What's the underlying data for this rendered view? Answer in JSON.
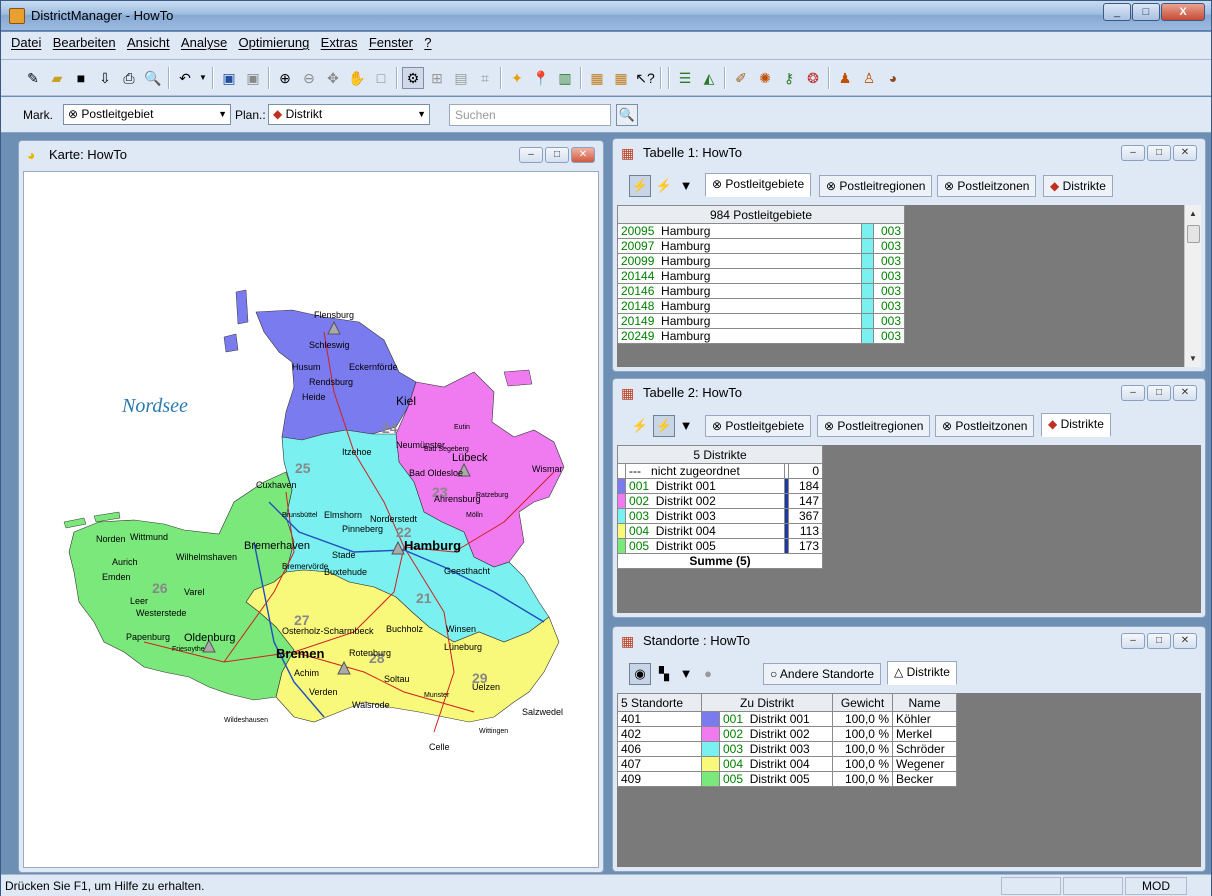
{
  "window": {
    "title": "DistrictManager - HowTo",
    "minimize": "_",
    "maximize": "□",
    "close": "X"
  },
  "menu": [
    "Datei",
    "Bearbeiten",
    "Ansicht",
    "Analyse",
    "Optimierung",
    "Extras",
    "Fenster",
    "?"
  ],
  "toolbar2": {
    "mark_label": "Mark.",
    "mark_value": "Postleitgebiet",
    "plan_label": "Plan.:",
    "plan_value": "Distrikt",
    "search_placeholder": "Suchen"
  },
  "map_window": {
    "title": "Karte: HowTo",
    "sea_label": "Nordsee",
    "district_numbers": [
      "24",
      "25",
      "22",
      "23",
      "26",
      "27",
      "21",
      "28",
      "29"
    ],
    "cities": [
      "Flensburg",
      "Schleswig",
      "Husum",
      "Eckernförde",
      "Rendsburg",
      "Heide",
      "Kiel",
      "Neumünster",
      "Lübeck",
      "Wismar",
      "Itzehoe",
      "Elmshorn",
      "Pinneberg",
      "Norderstedt",
      "Bad Oldesloe",
      "Ahrensburg",
      "Hamburg",
      "Geesthacht",
      "Stade",
      "Buxtehude",
      "Cuxhaven",
      "Bremerhaven",
      "Bremervörde",
      "Norden",
      "Wittmund",
      "Aurich",
      "Wilhelmshaven",
      "Emden",
      "Leer",
      "Varel",
      "Westerstede",
      "Papenburg",
      "Oldenburg",
      "Friesoythe",
      "Osterholz-Scharmbeck",
      "Bremen",
      "Rotenburg",
      "Buchholz",
      "Winsen",
      "Lüneburg",
      "Achim",
      "Verden",
      "Soltau",
      "Walsrode",
      "Uelzen",
      "Munster",
      "Salzwedel",
      "Celle",
      "Wildeshausen",
      "Wittingen",
      "Brunsbüttel",
      "Bad Segeberg",
      "Eutin",
      "Mölln",
      "Ratzeburg"
    ]
  },
  "table1": {
    "title": "Tabelle 1: HowTo",
    "tabs": [
      "Postleitgebiete",
      "Postleitregionen",
      "Postleitzonen",
      "Distrikte"
    ],
    "header": "984 Postleitgebiete",
    "rows": [
      {
        "code": "20095",
        "name": "Hamburg",
        "district": "003"
      },
      {
        "code": "20097",
        "name": "Hamburg",
        "district": "003"
      },
      {
        "code": "20099",
        "name": "Hamburg",
        "district": "003"
      },
      {
        "code": "20144",
        "name": "Hamburg",
        "district": "003"
      },
      {
        "code": "20146",
        "name": "Hamburg",
        "district": "003"
      },
      {
        "code": "20148",
        "name": "Hamburg",
        "district": "003"
      },
      {
        "code": "20149",
        "name": "Hamburg",
        "district": "003"
      },
      {
        "code": "20249",
        "name": "Hamburg",
        "district": "003"
      }
    ]
  },
  "table2": {
    "title": "Tabelle 2: HowTo",
    "tabs": [
      "Postleitgebiete",
      "Postleitregionen",
      "Postleitzonen",
      "Distrikte"
    ],
    "header": "5 Distrikte",
    "unassigned": {
      "code": "---",
      "name": "nicht zugeordnet",
      "count": "0"
    },
    "rows": [
      {
        "code": "001",
        "name": "Distrikt 001",
        "count": "184"
      },
      {
        "code": "002",
        "name": "Distrikt 002",
        "count": "147"
      },
      {
        "code": "003",
        "name": "Distrikt 003",
        "count": "367"
      },
      {
        "code": "004",
        "name": "Distrikt 004",
        "count": "113"
      },
      {
        "code": "005",
        "name": "Distrikt 005",
        "count": "173"
      }
    ],
    "sum": "Summe (5)"
  },
  "standorte": {
    "title": "Standorte : HowTo",
    "tabs": [
      "Andere Standorte",
      "Distrikte"
    ],
    "headers": [
      "5 Standorte",
      "Zu Distrikt",
      "Gewicht",
      "Name"
    ],
    "rows": [
      {
        "id": "401",
        "code": "001",
        "district": "Distrikt 001",
        "weight": "100,0 %",
        "name": "Köhler"
      },
      {
        "id": "402",
        "code": "002",
        "district": "Distrikt 002",
        "weight": "100,0 %",
        "name": "Merkel"
      },
      {
        "id": "406",
        "code": "003",
        "district": "Distrikt 003",
        "weight": "100,0 %",
        "name": "Schröder"
      },
      {
        "id": "407",
        "code": "004",
        "district": "Distrikt 004",
        "weight": "100,0 %",
        "name": "Wegener"
      },
      {
        "id": "409",
        "code": "005",
        "district": "Distrikt 005",
        "weight": "100,0 %",
        "name": "Becker"
      }
    ]
  },
  "district_colors": {
    "001": "#7b7bf0",
    "002": "#f07bf0",
    "003": "#7bf0f0",
    "004": "#f8f87b",
    "005": "#7be87b"
  },
  "status": {
    "text": "Drücken Sie F1, um Hilfe zu erhalten.",
    "mode": "MOD"
  }
}
